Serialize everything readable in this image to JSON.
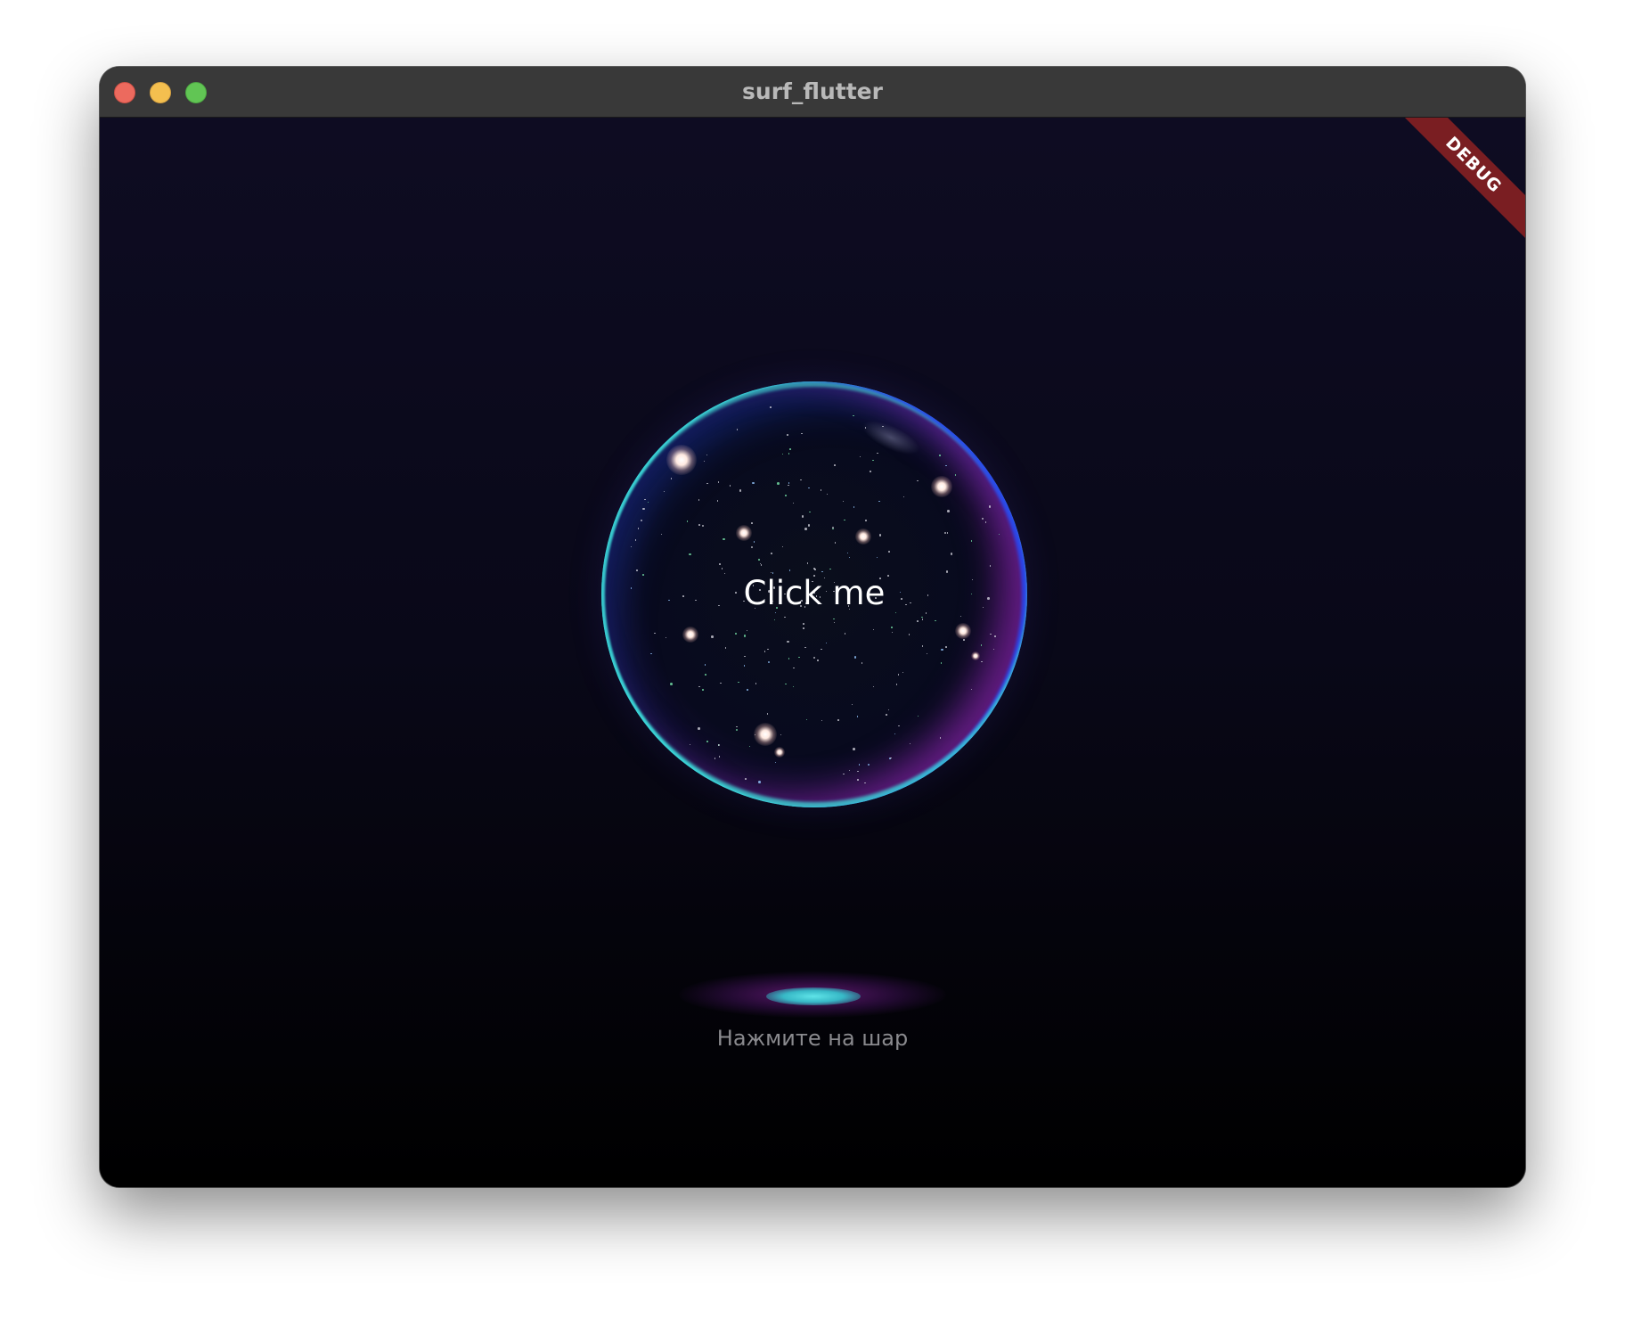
{
  "window": {
    "title": "surf_flutter"
  },
  "debug_banner": {
    "label": "DEBUG"
  },
  "sphere": {
    "button_label": "Click me"
  },
  "hint": {
    "text": "Нажмите на шар"
  },
  "colors": {
    "background_top": "#0e0c22",
    "background_bottom": "#000000",
    "sphere_rim_cyan": "#3cdcdc",
    "sphere_rim_magenta": "#aa28c8",
    "debug_banner": "#7a1e22",
    "platform_core": "#5fe4e8"
  }
}
